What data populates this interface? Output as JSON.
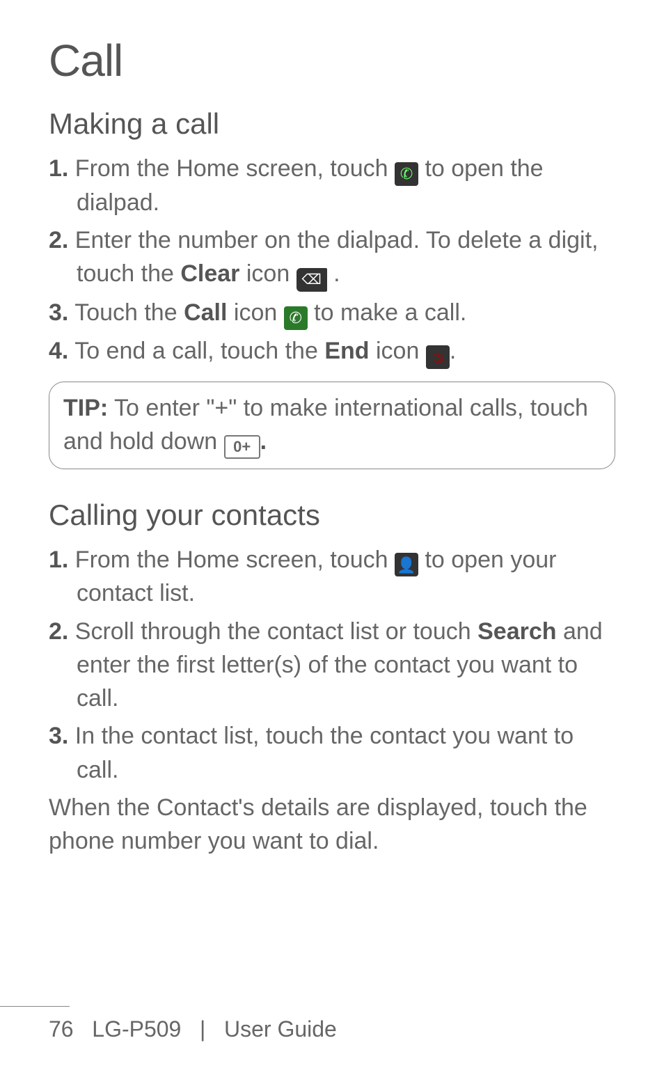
{
  "title": "Call",
  "section_1": {
    "heading": "Making a call",
    "steps": [
      {
        "num": "1.",
        "pre": " From the Home screen, touch ",
        "icon": "phone-icon",
        "post": " to open the dialpad."
      },
      {
        "num": "2.",
        "pre": " Enter the number on the dialpad. To delete a digit, touch the ",
        "bold": "Clear",
        "mid": " icon ",
        "icon": "clear-icon",
        "post": " ."
      },
      {
        "num": "3.",
        "pre": " Touch the ",
        "bold": "Call",
        "mid": " icon ",
        "icon": "call-icon",
        "post": " to make a call."
      },
      {
        "num": "4.",
        "pre": " To end a call, touch the ",
        "bold": "End",
        "mid": " icon ",
        "icon": "end-icon",
        "post": "."
      }
    ],
    "tip": {
      "label": "TIP:",
      "body_pre": " To enter \"+\" to make international calls, touch and hold down ",
      "key_label": "0+",
      "body_post": "."
    }
  },
  "section_2": {
    "heading": "Calling your contacts",
    "steps": [
      {
        "num": "1.",
        "pre": " From the Home screen, touch ",
        "icon": "contacts-icon",
        "post": " to open your contact list."
      },
      {
        "num": "2.",
        "pre": " Scroll through the contact list or touch ",
        "bold": "Search",
        "post": " and enter the first letter(s) of the contact you want to call."
      },
      {
        "num": "3.",
        "pre": " In the contact list, touch the contact you want to call."
      }
    ],
    "body": "When the Contact's details are displayed, touch the phone number you want to dial."
  },
  "footer": {
    "page": "76",
    "model": "LG-P509",
    "sep": "|",
    "label": "User Guide"
  }
}
